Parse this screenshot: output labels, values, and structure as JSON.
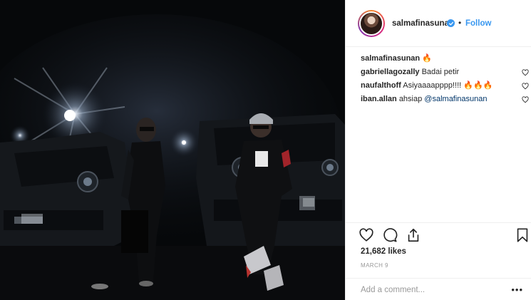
{
  "post": {
    "username": "salmafinasunan",
    "separator": "•",
    "follow_label": "Follow",
    "caption": {
      "user": "salmafinasunan",
      "text": "🔥"
    },
    "comments": [
      {
        "user": "gabriellagozally",
        "text": "Badai petir"
      },
      {
        "user": "naufalthoff",
        "text": "Asiyaaaapppp!!!! 🔥🔥🔥"
      },
      {
        "user": "iban.allan",
        "text": "ahsiap",
        "mention": "@salmafinasunan"
      }
    ],
    "likes": "21,682 likes",
    "date": "MARCH 9",
    "add_comment_placeholder": "Add a comment...",
    "more_label": "•••"
  },
  "icons": {
    "like": "heart-icon",
    "comment": "comment-icon",
    "share": "share-icon",
    "save": "bookmark-icon",
    "verified": "verified-badge-icon",
    "comment_like": "small-heart-icon"
  },
  "colors": {
    "link_blue": "#3897f0",
    "text": "#262626",
    "muted": "#999999",
    "mention": "#003569"
  }
}
